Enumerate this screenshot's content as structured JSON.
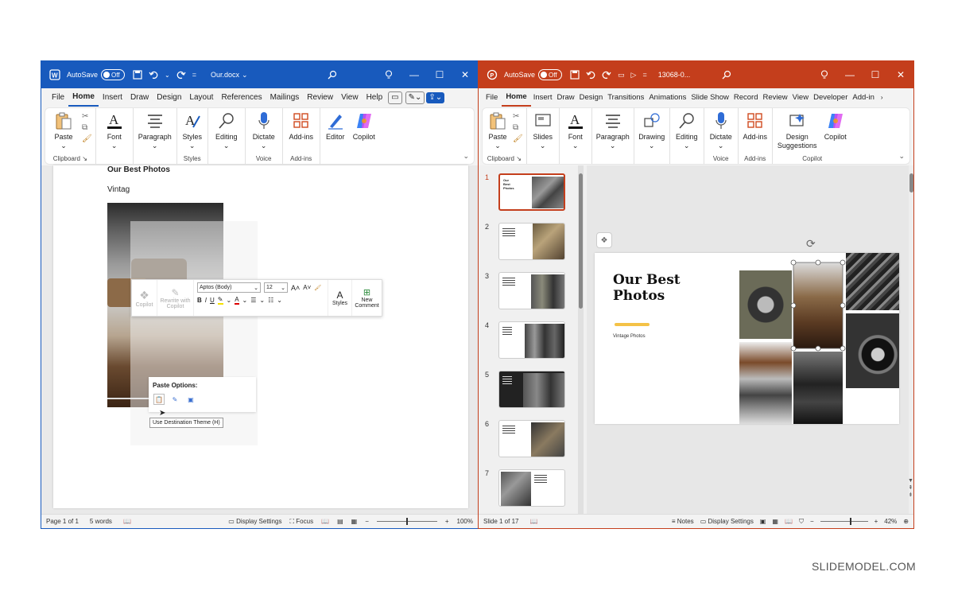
{
  "watermark": "SLIDEMODEL.COM",
  "colors": {
    "word_accent": "#185abd",
    "ppt_accent": "#c43e1c",
    "title_bar_yellow": "#f4c247"
  },
  "word": {
    "autosave": "AutoSave",
    "autosave_state": "Off",
    "filename": "Our.docx",
    "tabs": [
      "File",
      "Home",
      "Insert",
      "Draw",
      "Design",
      "Layout",
      "References",
      "Mailings",
      "Review",
      "View",
      "Help"
    ],
    "active_tab": "Home",
    "ribbon": {
      "clipboard": {
        "paste": "Paste",
        "group": "Clipboard"
      },
      "font": "Font",
      "paragraph": "Paragraph",
      "styles": {
        "button": "Styles",
        "group": "Styles"
      },
      "editing": "Editing",
      "voice": {
        "button": "Dictate",
        "group": "Voice"
      },
      "addins": {
        "button": "Add-ins",
        "group": "Add-ins"
      },
      "editor": "Editor",
      "copilot": "Copilot"
    },
    "doc": {
      "heading": "Our Best Photos",
      "body": "Vintag"
    },
    "mini_toolbar": {
      "copilot": "Copilot",
      "rewrite": "Rewrite with Copilot",
      "font": "Aptos (Body)",
      "size": "12",
      "styles": "Styles",
      "new_comment": "New Comment"
    },
    "paste_options": {
      "title": "Paste Options:",
      "tooltip": "Use Destination Theme (H)"
    },
    "status": {
      "page": "Page 1 of 1",
      "words": "5 words",
      "display_settings": "Display Settings",
      "focus": "Focus",
      "zoom": "100%"
    }
  },
  "ppt": {
    "autosave": "AutoSave",
    "autosave_state": "Off",
    "filename": "13068-0...",
    "tabs": [
      "File",
      "Home",
      "Insert",
      "Draw",
      "Design",
      "Transitions",
      "Animations",
      "Slide Show",
      "Record",
      "Review",
      "View",
      "Developer",
      "Add-in"
    ],
    "active_tab": "Home",
    "ribbon": {
      "clipboard": {
        "paste": "Paste",
        "group": "Clipboard"
      },
      "slides": "Slides",
      "font": "Font",
      "paragraph": "Paragraph",
      "drawing": "Drawing",
      "editing": "Editing",
      "voice": {
        "button": "Dictate",
        "group": "Voice"
      },
      "addins": {
        "button": "Add-ins",
        "group": "Add-ins"
      },
      "design_suggestions": "Design Suggestions",
      "copilot": {
        "button": "Copilot",
        "group": "Copilot"
      }
    },
    "thumbnails": [
      "1",
      "2",
      "3",
      "4",
      "5",
      "6",
      "7"
    ],
    "slide": {
      "title": "Our Best Photos",
      "subtitle": "Vintage Photos"
    },
    "status": {
      "slide": "Slide 1 of 17",
      "notes": "Notes",
      "display_settings": "Display Settings",
      "zoom": "42%"
    }
  }
}
